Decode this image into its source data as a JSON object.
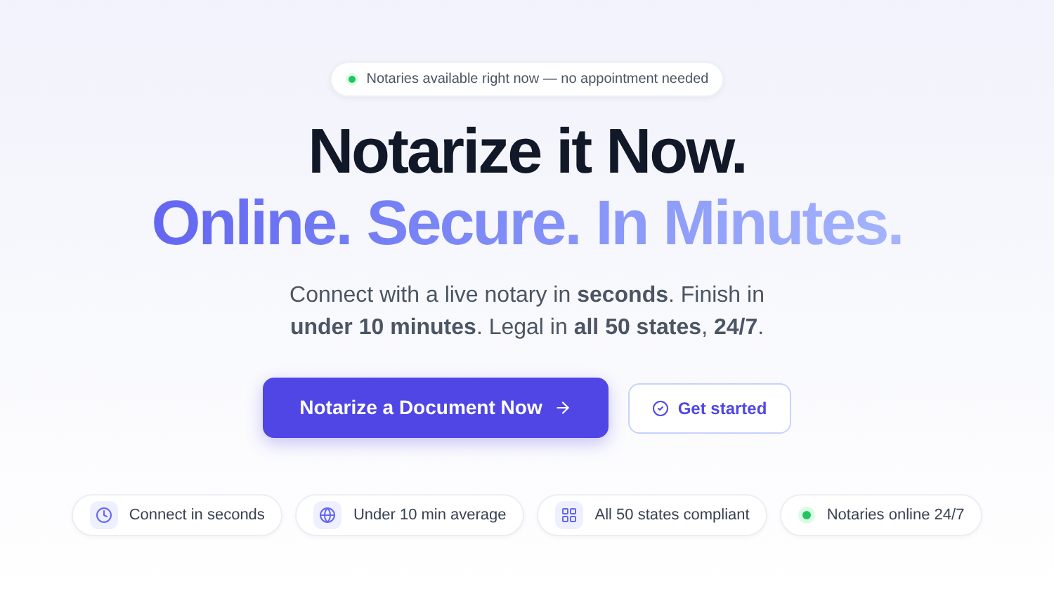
{
  "announcement": {
    "text": "Notaries available right now — no appointment needed"
  },
  "headline": {
    "line_1": "Notarize it Now.",
    "line_2": "Online. Secure. In Minutes."
  },
  "subtitle": "Connect with a live notary in **seconds**. Finish in **under 10 minutes**. Legal in **all 50 states**, **24/7**.",
  "buttons": [
    {
      "kind": "primary",
      "label": "Notarize a Document Now"
    },
    {
      "kind": "secondary",
      "label": "Get started"
    }
  ],
  "features": [
    {
      "kind": "clock",
      "label": "Connect in seconds"
    },
    {
      "kind": "globe",
      "label": "Under 10 min average"
    },
    {
      "kind": "grid",
      "label": "All 50 states compliant"
    },
    {
      "kind": "dot",
      "label": "Notaries online 24/7"
    }
  ]
}
